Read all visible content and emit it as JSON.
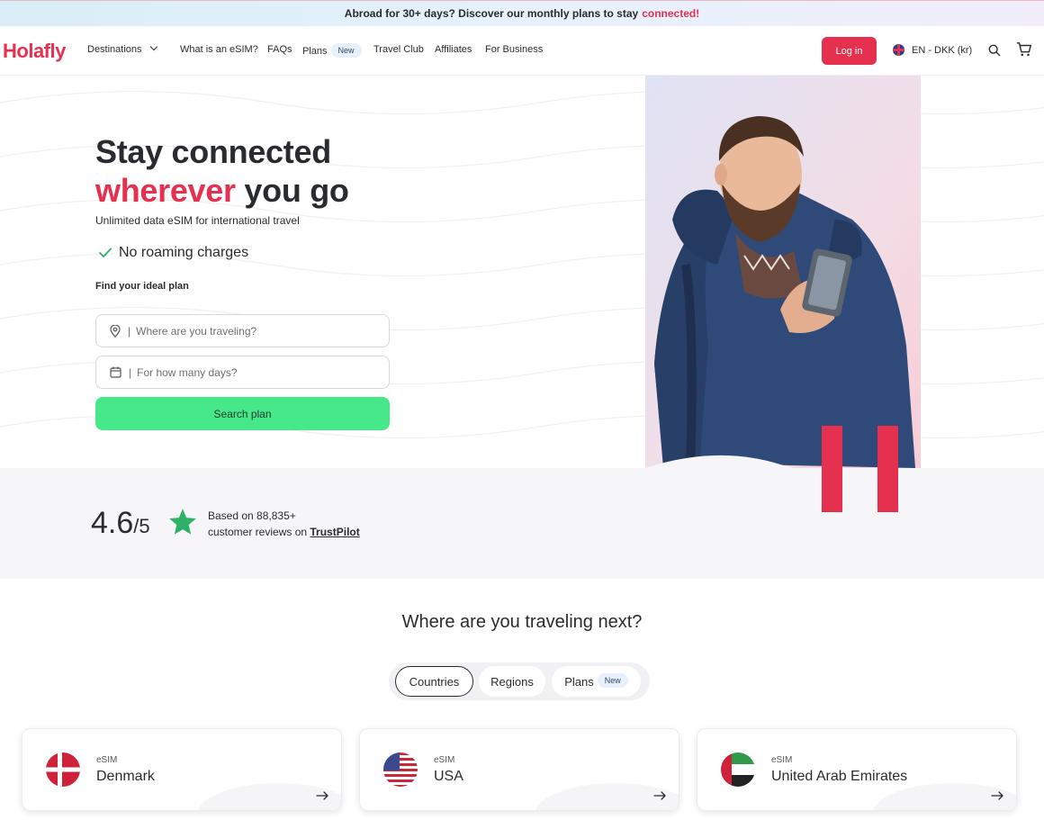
{
  "banner": {
    "text": "Abroad for 30+ days? Discover our monthly plans to stay",
    "accent": "connected!"
  },
  "nav": {
    "logo": "Holafly",
    "items": {
      "destinations": "Destinations",
      "esim": "What is an eSIM?",
      "faqs": "FAQs",
      "plans": "Plans",
      "plans_badge": "New",
      "travel_club": "Travel Club",
      "affiliates": "Affiliates",
      "business": "For Business"
    },
    "login": "Log in",
    "language": "EN - DKK (kr)"
  },
  "hero": {
    "title_line1": "Stay connected",
    "title_accent": "wherever",
    "title_rest": "you go",
    "subtitle": "Unlimited data eSIM for international travel",
    "benefit": "No roaming charges",
    "find_label": "Find your ideal plan",
    "destination_placeholder": "Where are you traveling?",
    "days_placeholder": "For how many days?",
    "search_button": "Search plan"
  },
  "reviews": {
    "score": "4.6",
    "out_of": "/5",
    "based_line1": "Based on 88,835+",
    "based_line2": "customer reviews on",
    "source": "TrustPilot"
  },
  "destinations": {
    "heading": "Where are you traveling next?",
    "tabs": {
      "countries": "Countries",
      "regions": "Regions",
      "plans": "Plans",
      "plans_badge": "New"
    },
    "cards": [
      {
        "type": "eSIM",
        "name": "Denmark"
      },
      {
        "type": "eSIM",
        "name": "USA"
      },
      {
        "type": "eSIM",
        "name": "United Arab Emirates"
      }
    ]
  },
  "colors": {
    "brand": "#e5304f",
    "cta": "#47e88a",
    "text": "#292b2e"
  }
}
